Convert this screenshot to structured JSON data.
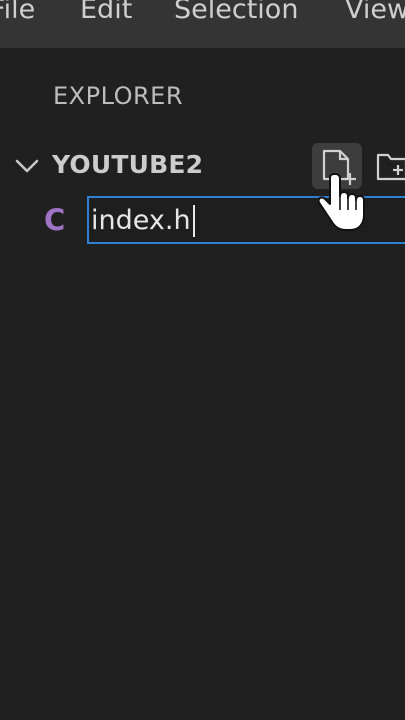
{
  "menubar": {
    "items": [
      "File",
      "Edit",
      "Selection",
      "View"
    ]
  },
  "sidebar": {
    "title": "EXPLORER",
    "folder": {
      "name": "YOUTUBE2",
      "expanded": true,
      "actions": [
        {
          "icon": "new-file-icon"
        },
        {
          "icon": "new-folder-icon"
        }
      ]
    },
    "new_file": {
      "lang_icon": "C",
      "lang_icon_color": "#a074c4",
      "value": "index.h"
    }
  },
  "colors": {
    "accent": "#2f7fd0",
    "menubar_bg": "#343434",
    "sidebar_bg": "#202020"
  }
}
